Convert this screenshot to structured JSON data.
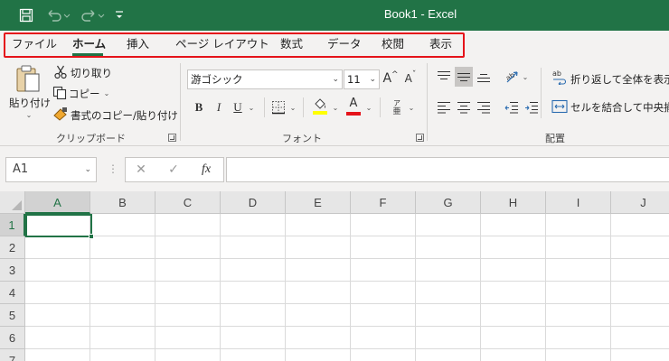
{
  "window": {
    "title": "Book1  -  Excel",
    "brand_color": "#217346"
  },
  "quick_access": {
    "save_icon": "save-icon",
    "undo_icon": "undo-icon",
    "redo_icon": "redo-icon",
    "customize_icon": "customize-qat-icon"
  },
  "tabs": [
    {
      "label": "ファイル",
      "active": false
    },
    {
      "label": "ホーム",
      "active": true
    },
    {
      "label": "挿入",
      "active": false
    },
    {
      "label": "ページ レイアウト",
      "active": false
    },
    {
      "label": "数式",
      "active": false
    },
    {
      "label": "データ",
      "active": false
    },
    {
      "label": "校閲",
      "active": false
    },
    {
      "label": "表示",
      "active": false
    }
  ],
  "tab_highlight_color": "#e5131a",
  "clipboard": {
    "paste_label": "貼り付け",
    "cut_label": "切り取り",
    "copy_label": "コピー",
    "format_painter_label": "書式のコピー/貼り付け",
    "group_label": "クリップボード"
  },
  "font": {
    "font_name": "游ゴシック",
    "font_size": "11",
    "grow_label": "A",
    "shrink_label": "A",
    "bold": "B",
    "italic": "I",
    "underline": "U",
    "highlight_color": "#ffff00",
    "font_color": "#e5131a",
    "font_color_letter": "A",
    "highlight_letter": "A",
    "phonetic_label": "ア",
    "group_label": "フォント"
  },
  "alignment": {
    "wrap_label": "折り返して全体を表示す",
    "merge_label": "セルを結合して中央揃え",
    "group_label": "配置"
  },
  "formula_bar": {
    "name_box": "A1",
    "cancel_symbol": "✕",
    "enter_symbol": "✓",
    "fx_label": "fx",
    "formula_value": ""
  },
  "grid": {
    "columns": [
      "A",
      "B",
      "C",
      "D",
      "E",
      "F",
      "G",
      "H",
      "I",
      "J"
    ],
    "rows": [
      "1",
      "2",
      "3",
      "4",
      "5",
      "6",
      "7"
    ],
    "selected_cell": "A1"
  }
}
